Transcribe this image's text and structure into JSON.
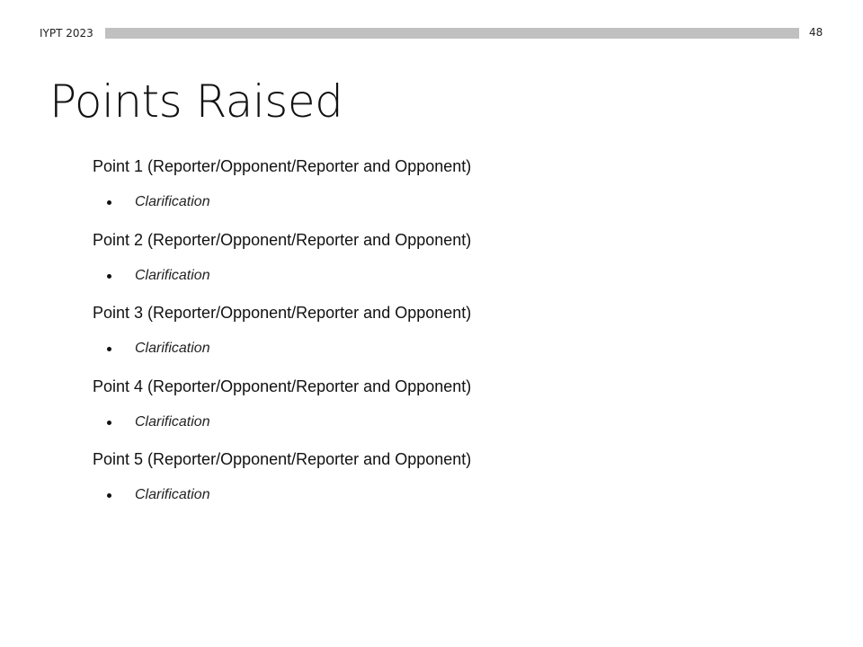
{
  "header": {
    "label": "IYPT 2023",
    "page_number": "48"
  },
  "slide": {
    "title": "Points Raised"
  },
  "points": [
    {
      "heading": "Point 1 (Reporter/Opponent/Reporter and Opponent)",
      "clarification": "Clarification"
    },
    {
      "heading": "Point 2 (Reporter/Opponent/Reporter and Opponent)",
      "clarification": "Clarification"
    },
    {
      "heading": "Point 3 (Reporter/Opponent/Reporter and Opponent)",
      "clarification": "Clarification"
    },
    {
      "heading": "Point 4 (Reporter/Opponent/Reporter and Opponent)",
      "clarification": "Clarification"
    },
    {
      "heading": "Point 5 (Reporter/Opponent/Reporter and Opponent)",
      "clarification": "Clarification"
    }
  ],
  "colors": {
    "header_bar": "#c0c0c0",
    "text": "#111111",
    "background": "#ffffff"
  }
}
